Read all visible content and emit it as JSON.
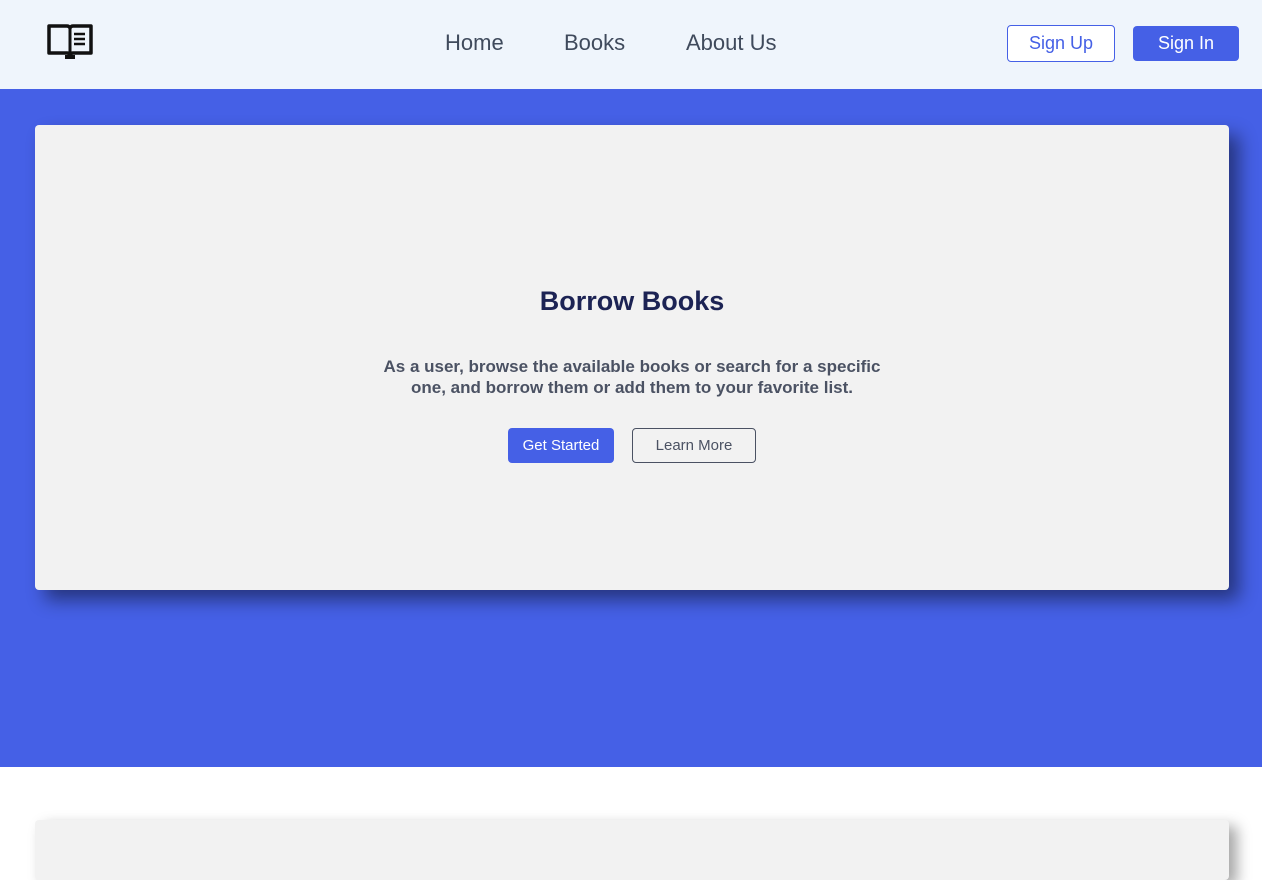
{
  "navbar": {
    "logo_icon": "open-book-icon",
    "links": [
      {
        "label": "Home"
      },
      {
        "label": "Books"
      },
      {
        "label": "About Us"
      }
    ],
    "signup_label": "Sign Up",
    "signin_label": "Sign In"
  },
  "hero": {
    "title": "Borrow Books",
    "description": "As a user, browse the available books or search for a specific one, and borrow them or add them to your favorite list.",
    "primary_button": "Get Started",
    "secondary_button": "Learn More"
  },
  "colors": {
    "accent": "#4560e6",
    "navbar_bg": "#eff5fc",
    "card_bg": "#f2f2f2",
    "title": "#1c2354",
    "text": "#4b5263"
  }
}
